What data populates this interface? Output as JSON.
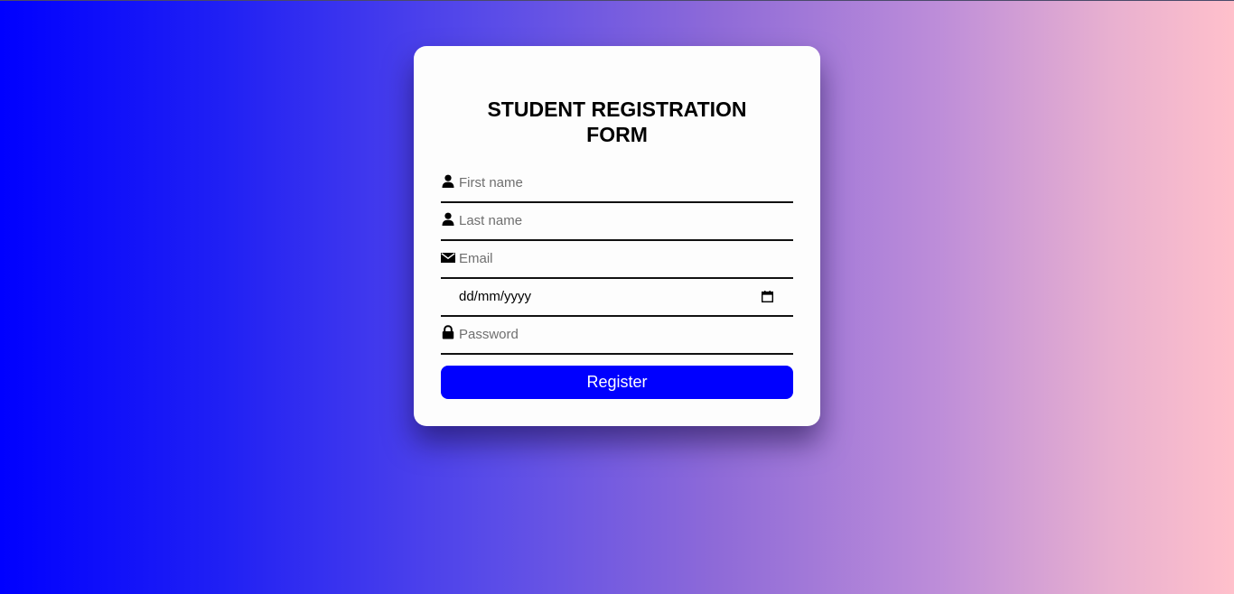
{
  "form": {
    "title_line1": "STUDENT REGISTRATION",
    "title_line2": "FORM",
    "first_name": {
      "placeholder": "First name",
      "icon": "user-icon"
    },
    "last_name": {
      "placeholder": "Last name",
      "icon": "user-icon"
    },
    "email": {
      "placeholder": "Email",
      "icon": "envelope-icon"
    },
    "dob": {
      "value": "dd/mm/yyyy",
      "icon": "calendar-icon"
    },
    "password": {
      "placeholder": "Password",
      "icon": "lock-icon"
    },
    "register_label": "Register"
  },
  "colors": {
    "gradient_start": "#0000ff",
    "gradient_end": "#ffc0cb",
    "button": "#0000ff",
    "card": "#fdfdfd"
  }
}
